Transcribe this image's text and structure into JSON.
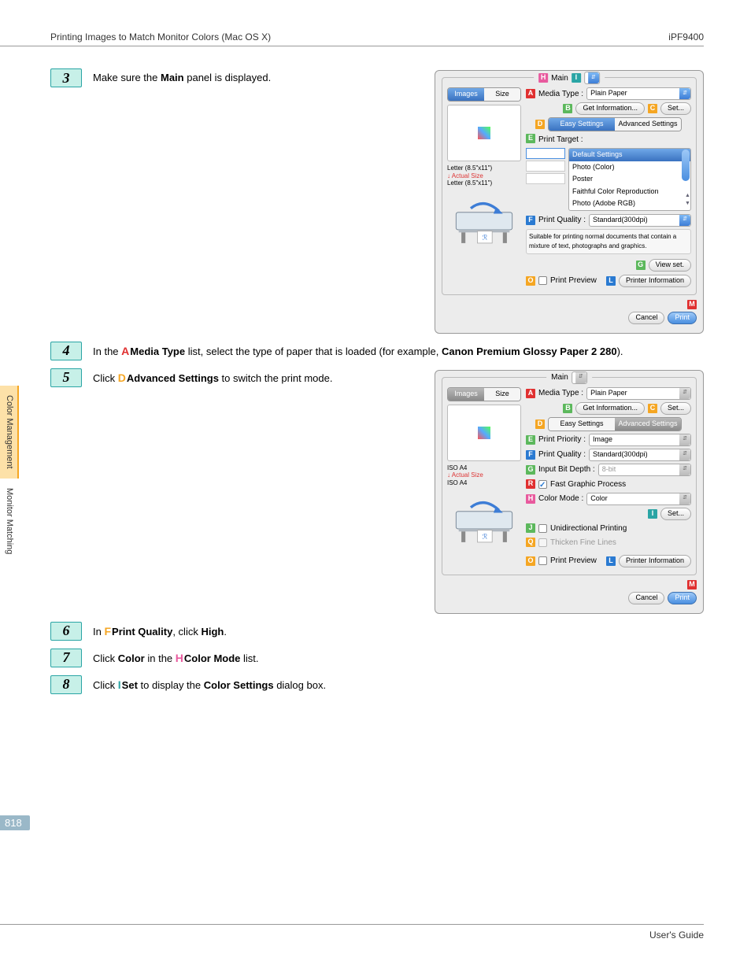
{
  "header": {
    "left": "Printing Images to Match Monitor Colors (Mac OS X)",
    "right": "iPF9400"
  },
  "side_tabs": [
    "Color Management",
    "Monitor Matching"
  ],
  "steps": {
    "s3": {
      "num": "3",
      "text_pre": "Make sure the ",
      "bold": "Main",
      "text_post": " panel is displayed."
    },
    "s4": {
      "num": "4",
      "pre": "In the ",
      "letter": "A",
      "label": "Media Type",
      "mid": " list, select the type of paper that is loaded (for example, ",
      "example": "Canon Premium Glossy Paper 2 280",
      "post": ")."
    },
    "s5": {
      "num": "5",
      "pre": "Click ",
      "letter": "D",
      "label": "Advanced Settings",
      "post": " to switch the print mode."
    },
    "s6": {
      "num": "6",
      "pre": "In ",
      "letter": "F",
      "label": "Print Quality",
      "post": ", click ",
      "bold2": "High",
      "post2": "."
    },
    "s7": {
      "num": "7",
      "pre": "Click ",
      "bold1": "Color",
      "mid": " in the ",
      "letter": "H",
      "label": "Color Mode",
      "post": " list."
    },
    "s8": {
      "num": "8",
      "pre": "Click ",
      "letter": "I",
      "label": "Set",
      "mid": " to display the ",
      "bold2": "Color Settings",
      "post": " dialog box."
    }
  },
  "shot1": {
    "title": "Main",
    "tabs": {
      "images": "Images",
      "size": "Size"
    },
    "media_type_label": "Media Type :",
    "media_type_value": "Plain Paper",
    "get_info": "Get Information...",
    "set": "Set...",
    "easy": "Easy Settings",
    "advanced": "Advanced Settings",
    "print_target_label": "Print Target :",
    "targets": [
      "Default Settings",
      "Photo (Color)",
      "Poster",
      "Faithful Color Reproduction",
      "Photo (Adobe RGB)"
    ],
    "print_quality_label": "Print Quality :",
    "print_quality_value": "Standard(300dpi)",
    "hint": "Suitable for printing normal documents that contain a mixture of text, photographs and graphics.",
    "view_set": "View set.",
    "print_preview": "Print Preview",
    "printer_info": "Printer Information",
    "cancel": "Cancel",
    "print": "Print",
    "paper_size_lines": [
      "Letter (8.5\"x11\")",
      "↓ Actual Size",
      "Letter (8.5\"x11\")"
    ],
    "callouts": {
      "H": "H",
      "I": "I",
      "A": "A",
      "B": "B",
      "C": "C",
      "D": "D",
      "E": "E",
      "F": "F",
      "G": "G",
      "O": "O",
      "L": "L",
      "M": "M"
    }
  },
  "shot2": {
    "title": "Main",
    "tabs": {
      "images": "Images",
      "size": "Size"
    },
    "media_type_label": "Media Type :",
    "media_type_value": "Plain Paper",
    "get_info": "Get Information...",
    "set": "Set...",
    "easy": "Easy Settings",
    "advanced": "Advanced Settings",
    "print_priority_label": "Print Priority :",
    "print_priority_value": "Image",
    "print_quality_label": "Print Quality :",
    "print_quality_value": "Standard(300dpi)",
    "input_bit_label": "Input Bit Depth :",
    "input_bit_value": "8-bit",
    "fast_graphic": "Fast Graphic Process",
    "color_mode_label": "Color Mode :",
    "color_mode_value": "Color",
    "set2": "Set...",
    "unidir": "Unidirectional Printing",
    "thicken": "Thicken Fine Lines",
    "print_preview": "Print Preview",
    "printer_info": "Printer Information",
    "cancel": "Cancel",
    "print": "Print",
    "paper_size_lines": [
      "ISO A4",
      "↓ Actual Size",
      "ISO A4"
    ],
    "callouts": {
      "A": "A",
      "B": "B",
      "C": "C",
      "D": "D",
      "E": "E",
      "F": "F",
      "G": "G",
      "H": "H",
      "I": "I",
      "J": "J",
      "Q": "Q",
      "R": "R",
      "O": "O",
      "L": "L",
      "M": "M"
    }
  },
  "page_number": "818",
  "footer": "User's Guide"
}
